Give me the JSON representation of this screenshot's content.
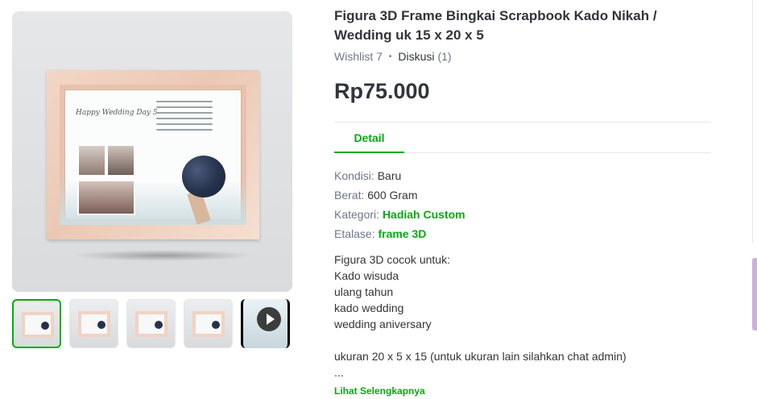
{
  "product": {
    "title": "Figura 3D Frame Bingkai Scrapbook Kado Nikah / Wedding uk 15 x 20 x 5",
    "wishlist": "Wishlist 7",
    "diskusi_label": "Diskusi",
    "diskusi_count": "(1)",
    "price": "Rp75.000"
  },
  "image": {
    "handwriting": "Happy Wedding Day 5"
  },
  "tabs": [
    {
      "label": "Detail",
      "active": true
    }
  ],
  "specs": [
    {
      "key": "Kondisi:",
      "value": "Baru",
      "link": false
    },
    {
      "key": "Berat:",
      "value": "600 Gram",
      "link": false
    },
    {
      "key": "Kategori:",
      "value": "Hadiah Custom",
      "link": true
    },
    {
      "key": "Etalase:",
      "value": "frame 3D",
      "link": true
    }
  ],
  "description": {
    "lines": [
      "Figura 3D cocok untuk:",
      "Kado wisuda",
      "ulang tahun",
      "kado wedding",
      "wedding aniversary",
      "",
      "ukuran 20 x 5 x 15 (untuk ukuran lain silahkan chat admin)",
      "..."
    ],
    "more_label": "Lihat Selengkapnya"
  },
  "thumbnails": [
    {
      "name": "thumbnail-1",
      "active": true,
      "video": false
    },
    {
      "name": "thumbnail-2",
      "active": false,
      "video": false
    },
    {
      "name": "thumbnail-3",
      "active": false,
      "video": false
    },
    {
      "name": "thumbnail-4",
      "active": false,
      "video": false
    },
    {
      "name": "thumbnail-video",
      "active": false,
      "video": true,
      "icon": "play-icon"
    }
  ],
  "colors": {
    "accent": "#03ac0e",
    "text": "#31353b",
    "muted": "#6d7588"
  }
}
